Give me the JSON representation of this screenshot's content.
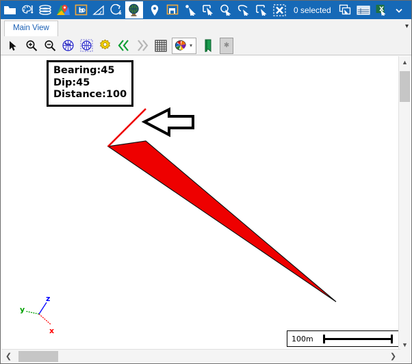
{
  "window": {
    "title": "Main View"
  },
  "topbar": {
    "selection_label": "0 selected",
    "buttons": [
      {
        "name": "open-folder-icon",
        "label": "Open Folder"
      },
      {
        "name": "palette-settings-icon",
        "label": "Display Settings"
      },
      {
        "name": "layers-icon",
        "label": "Layers"
      },
      {
        "name": "map-pin-icon",
        "label": "Map"
      },
      {
        "name": "bo-tool-icon",
        "label": "Borehole Tool"
      },
      {
        "name": "angle-measure-icon",
        "label": "Angle"
      },
      {
        "name": "orbit-icon",
        "label": "Orbit"
      },
      {
        "name": "globe-icon",
        "label": "Globe View"
      },
      {
        "name": "location-pin-icon",
        "label": "Location"
      },
      {
        "name": "window-frame-icon",
        "label": "Frame"
      },
      {
        "name": "select-point-icon",
        "label": "Select Point"
      },
      {
        "name": "select-rectangle-icon",
        "label": "Select Rectangle"
      },
      {
        "name": "select-circle-icon",
        "label": "Select Circle"
      },
      {
        "name": "select-lasso-icon",
        "label": "Select Lasso"
      },
      {
        "name": "select-box-icon",
        "label": "Select Box"
      },
      {
        "name": "clear-selection-icon",
        "label": "Clear Selection"
      },
      {
        "name": "copy-window-icon",
        "label": "Copy Window"
      },
      {
        "name": "table-icon",
        "label": "Table"
      },
      {
        "name": "excel-export-icon",
        "label": "Export To Excel"
      },
      {
        "name": "overflow-chevron-icon",
        "label": "More"
      }
    ]
  },
  "toolbar2": {
    "buttons": [
      {
        "name": "pointer-icon",
        "label": "Select"
      },
      {
        "name": "zoom-in-icon",
        "label": "Zoom In"
      },
      {
        "name": "zoom-out-icon",
        "label": "Zoom Out"
      },
      {
        "name": "globe-rotate-icon",
        "label": "Rotate View"
      },
      {
        "name": "globe-pan-icon",
        "label": "Pan View"
      },
      {
        "name": "gear-icon",
        "label": "Settings"
      },
      {
        "name": "prev-double-chevron-icon",
        "label": "Previous"
      },
      {
        "name": "next-double-chevron-icon",
        "label": "Next"
      },
      {
        "name": "grid-icon",
        "label": "Grid"
      },
      {
        "name": "color-palette-dropdown",
        "label": "Colors"
      },
      {
        "name": "bookmark-icon",
        "label": "Bookmark"
      },
      {
        "name": "star-icon",
        "label": "Favourite"
      }
    ]
  },
  "canvas": {
    "annotation": {
      "bearing_label": "Bearing:45",
      "dip_label": "Dip:45",
      "distance_label": "Distance:100"
    },
    "scalebar": {
      "text": "100m"
    },
    "axes": {
      "x_label": "x",
      "y_label": "y",
      "z_label": "z",
      "x_color": "#ff0000",
      "y_color": "#00a000",
      "z_color": "#0000ff"
    },
    "geometry": {
      "wedge_color": "#ee0000",
      "wedge_outline": "#000000",
      "line_color": "#ee0000",
      "pointer_arrow_color": "#000000"
    }
  }
}
